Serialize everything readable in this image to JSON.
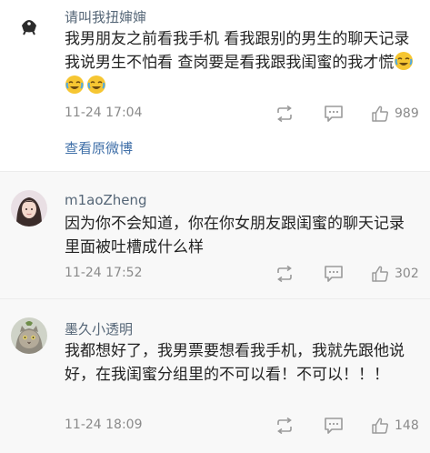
{
  "comments": [
    {
      "username": "请叫我扭婶婶",
      "text": "我男朋友之前看我手机 看我跟别的男生的聊天记录 我说男生不怕看 查岗要是看我跟我闺蜜的我才慌",
      "emojis": [
        "crying-laughing-emoji",
        "crying-laughing-emoji",
        "crying-laughing-emoji"
      ],
      "time": "11-24 17:04",
      "likes": "989",
      "link": "查看原微博"
    },
    {
      "username": "m1aoZheng",
      "text": "因为你不会知道，你在你女朋友跟闺蜜的聊天记录里面被吐槽成什么样",
      "time": "11-24 17:52",
      "likes": "302"
    },
    {
      "username": "墨久小透明",
      "text": "我都想好了，我男票要想看我手机，我就先跟他说好，在我闺蜜分组里的不可以看！不可以！！！",
      "time": "11-24 18:09",
      "likes": "148"
    }
  ],
  "colors": {
    "username": "#556677",
    "link": "#3f6fa8",
    "meta": "#8a8a8a",
    "alt_background": "#f8f8f8"
  },
  "icons": [
    "repost-icon",
    "comment-icon",
    "thumbs-up-icon"
  ]
}
